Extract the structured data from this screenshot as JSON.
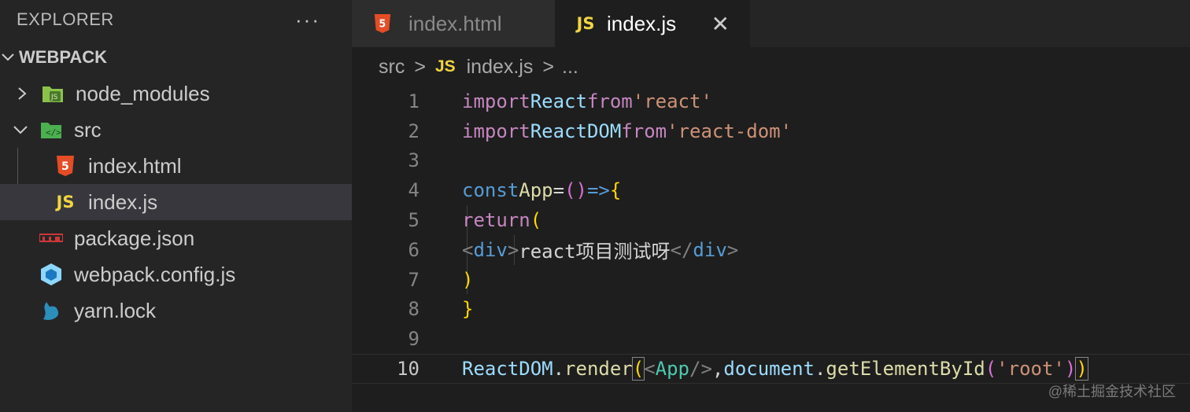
{
  "explorer": {
    "title": "EXPLORER",
    "more": "···",
    "section": "WEBPACK",
    "items": [
      {
        "label": "node_modules",
        "icon": "node-modules-folder-icon"
      },
      {
        "label": "src",
        "icon": "src-folder-icon"
      },
      {
        "label": "index.html",
        "icon": "html5-icon"
      },
      {
        "label": "index.js",
        "icon": "js-icon"
      },
      {
        "label": "package.json",
        "icon": "npm-icon"
      },
      {
        "label": "webpack.config.js",
        "icon": "webpack-icon"
      },
      {
        "label": "yarn.lock",
        "icon": "yarn-icon"
      }
    ]
  },
  "tabs": [
    {
      "label": "index.html",
      "icon_text": "5"
    },
    {
      "label": "index.js",
      "icon_text": "JS",
      "close": "✕"
    }
  ],
  "breadcrumb": {
    "folder": "src",
    "sep": ">",
    "file_icon": "JS",
    "file": "index.js",
    "more": "..."
  },
  "code": {
    "line_numbers": [
      "1",
      "2",
      "3",
      "4",
      "5",
      "6",
      "7",
      "8",
      "9",
      "10"
    ],
    "l1": {
      "import": "import",
      "name": "React",
      "from": "from",
      "src": "'react'"
    },
    "l2": {
      "import": "import",
      "name": "ReactDOM",
      "from": "from",
      "src": "'react-dom'"
    },
    "l4": {
      "const": "const",
      "name": "App",
      "eq": "=",
      "parens": "()",
      "arrow": "=>",
      "brace": "{"
    },
    "l5": {
      "return": "return",
      "paren": "("
    },
    "l6": {
      "lt": "<",
      "tag": "div",
      "gt": ">",
      "text": "react项目测试呀",
      "lt_close": "</",
      "tag_close": "div",
      "gt_close": ">"
    },
    "l7": {
      "paren": ")"
    },
    "l8": {
      "brace": "}"
    },
    "l10": {
      "obj": "ReactDOM",
      "dot": ".",
      "method": "render",
      "open": "(",
      "lt": "<",
      "comp": "App",
      "selfclose": "/>",
      "comma": ",",
      "doc": "document",
      "dot2": ".",
      "getter": "getElementById",
      "open2": "(",
      "arg": "'root'",
      "close2": ")",
      "close": ")"
    }
  },
  "watermark": "@稀土掘金技术社区",
  "colors": {
    "html5": "#e44d26",
    "js": "#f1d443",
    "npm": "#cb3837",
    "webpack": "#8ed6fb"
  }
}
